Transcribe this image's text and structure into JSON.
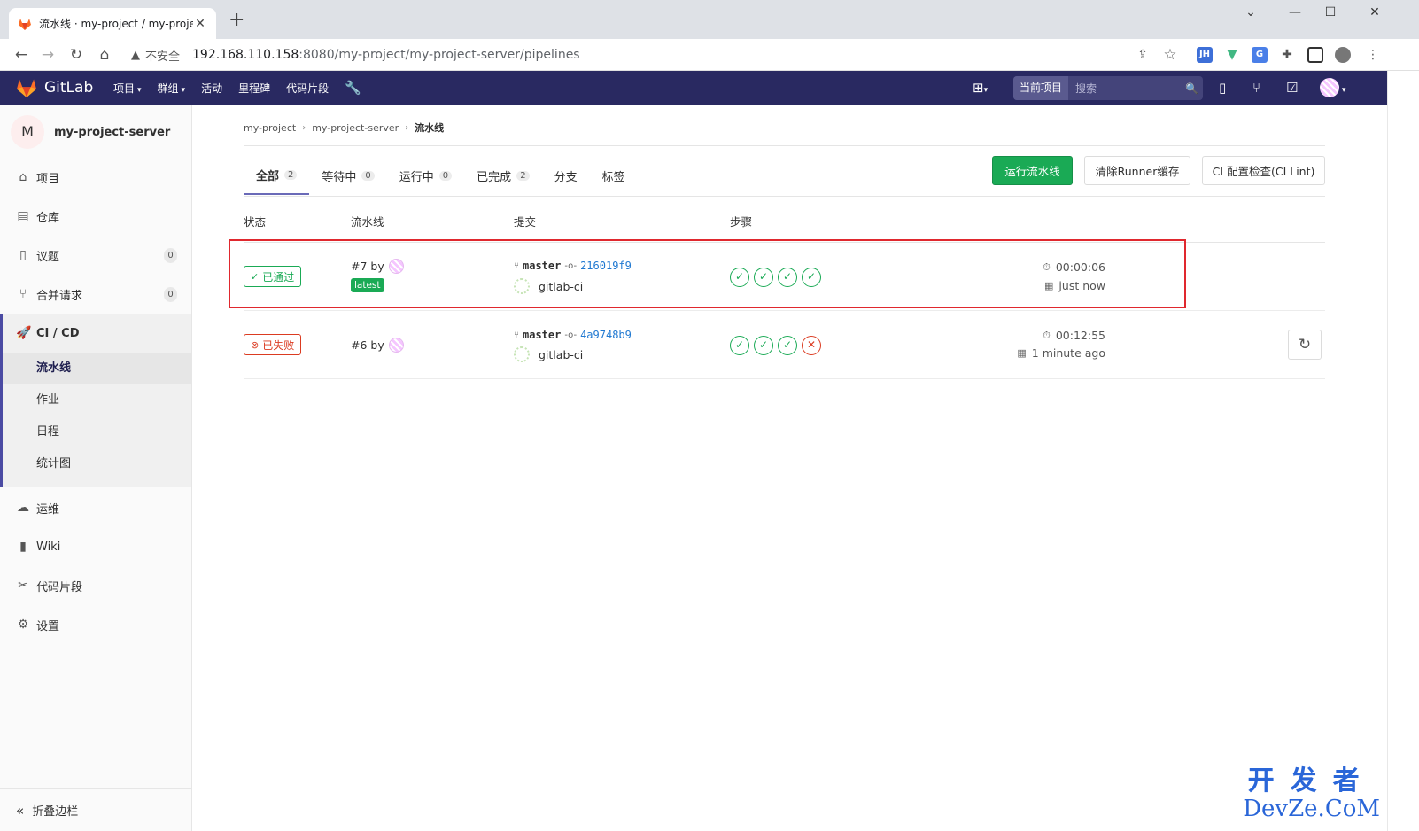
{
  "browser": {
    "tab_title": "流水线 · my-project / my-proje",
    "tab_close": "✕",
    "new_tab": "+",
    "security_label": "不安全",
    "url_host": "192.168.110.158",
    "url_path": ":8080/my-project/my-project-server/pipelines",
    "win_min": "—",
    "win_max": "☐",
    "win_close": "✕",
    "chevron": "⌄",
    "ext_jh": "JH"
  },
  "header": {
    "brand": "GitLab",
    "menu": [
      {
        "label": "项目",
        "caret": true
      },
      {
        "label": "群组",
        "caret": true
      },
      {
        "label": "活动",
        "caret": false
      },
      {
        "label": "里程碑",
        "caret": false
      },
      {
        "label": "代码片段",
        "caret": false
      }
    ],
    "search_scope": "当前项目",
    "search_placeholder": "搜索",
    "colors": {
      "bg": "#292961",
      "search": "#44447a"
    }
  },
  "sidebar": {
    "project_initial": "M",
    "project_name": "my-project-server",
    "items": [
      {
        "label": "项目",
        "icon": "home-icon",
        "count": null
      },
      {
        "label": "仓库",
        "icon": "doc-icon",
        "count": null
      },
      {
        "label": "议题",
        "icon": "issues-icon",
        "count": "0"
      },
      {
        "label": "合并请求",
        "icon": "merge-icon",
        "count": "0"
      },
      {
        "label": "CI / CD",
        "icon": "rocket-icon",
        "count": null
      },
      {
        "label": "运维",
        "icon": "cloud-gear-icon",
        "count": null
      },
      {
        "label": "Wiki",
        "icon": "book-icon",
        "count": null
      },
      {
        "label": "代码片段",
        "icon": "scissors-icon",
        "count": null
      },
      {
        "label": "设置",
        "icon": "gear-icon",
        "count": null
      }
    ],
    "cicd_sub": [
      "流水线",
      "作业",
      "日程",
      "统计图"
    ],
    "collapse_label": "折叠边栏"
  },
  "breadcrumb": [
    "my-project",
    "my-project-server",
    "流水线"
  ],
  "tabs": [
    {
      "label": "全部",
      "count": "2",
      "active": true
    },
    {
      "label": "等待中",
      "count": "0"
    },
    {
      "label": "运行中",
      "count": "0"
    },
    {
      "label": "已完成",
      "count": "2"
    },
    {
      "label": "分支",
      "count": null
    },
    {
      "label": "标签",
      "count": null
    }
  ],
  "actions": {
    "run_pipeline": "运行流水线",
    "clear_cache": "清除Runner缓存",
    "ci_lint": "CI 配置检查(CI Lint)"
  },
  "table_headers": [
    "状态",
    "流水线",
    "提交",
    "步骤"
  ],
  "pipelines": [
    {
      "status": "已通过",
      "status_kind": "passed",
      "id": "#7 by",
      "badge": "latest",
      "branch": "master",
      "sha": "216019f9",
      "author": "gitlab-ci",
      "stages": [
        "ok",
        "ok",
        "ok",
        "ok"
      ],
      "duration": "00:00:06",
      "finished": "just now"
    },
    {
      "status": "已失败",
      "status_kind": "failed",
      "id": "#6 by",
      "badge": null,
      "branch": "master",
      "sha": "4a9748b9",
      "author": "gitlab-ci",
      "stages": [
        "ok",
        "ok",
        "ok",
        "fail"
      ],
      "duration": "00:12:55",
      "finished": "1 minute ago"
    }
  ],
  "watermark": {
    "cn": "开发者",
    "en": "DevZe.CoM"
  },
  "colors": {
    "passed": "#1aaa55",
    "failed": "#db3b21",
    "highlight": "#e0282e",
    "link": "#1f78d1"
  }
}
